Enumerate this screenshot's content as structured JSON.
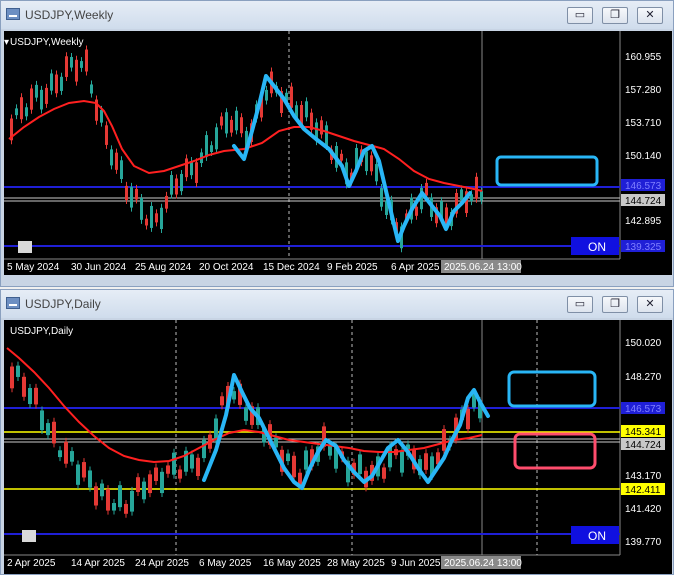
{
  "weekly": {
    "window_title": "USDJPY,Weekly",
    "symbol_label": "USDJPY,Weekly",
    "price_labels": [
      "160.955",
      "157.280",
      "153.710",
      "150.140",
      "146.573",
      "144.724",
      "142.895",
      "139.325"
    ],
    "date_labels": [
      "5 May 2024",
      "30 Jun 2024",
      "25 Aug 2024",
      "20 Oct 2024",
      "15 Dec 2024",
      "9 Feb 2025",
      "6 Apr 2025",
      "2025.06.24 13:00"
    ],
    "on_button": "ON"
  },
  "daily": {
    "window_title": "USDJPY,Daily",
    "symbol_label": "USDJPY,Daily",
    "price_labels": [
      "150.020",
      "148.270",
      "146.573",
      "145.341",
      "144.724",
      "143.170",
      "142.411",
      "141.420",
      "139.770"
    ],
    "date_labels": [
      "2 Apr 2025",
      "14 Apr 2025",
      "24 Apr 2025",
      "6 May 2025",
      "16 May 2025",
      "28 May 2025",
      "9 Jun 2025",
      "2025.06.24 13:00"
    ],
    "on_button": "ON"
  },
  "window_buttons": {
    "minimize": "▭",
    "restore": "❐",
    "close": "✕"
  },
  "colors": {
    "background": "#000000",
    "bull_candle": "#26a69a",
    "bear_candle": "#e53935",
    "moving_average": "#ff2020",
    "horizontal_line": "#1f1fd6",
    "support_line": "#ffff00",
    "drawing": "#29b6f6",
    "marker_box": "#ff4d6d",
    "on_button_bg": "#1010e0"
  }
}
